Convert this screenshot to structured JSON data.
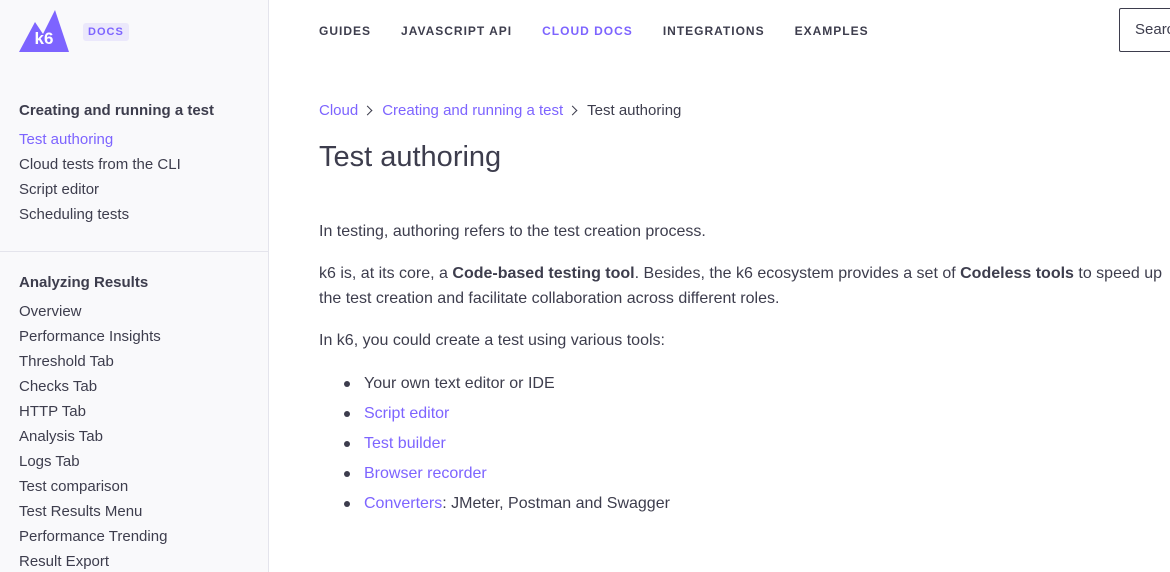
{
  "brand": {
    "logo_text": "k6",
    "badge": "DOCS",
    "accent_color": "#7d64ff",
    "logo_color": "#7d64ff"
  },
  "topnav": {
    "items": [
      {
        "label": "GUIDES"
      },
      {
        "label": "JAVASCRIPT API"
      },
      {
        "label": "CLOUD DOCS",
        "active": true
      },
      {
        "label": "INTEGRATIONS"
      },
      {
        "label": "EXAMPLES"
      }
    ],
    "search_placeholder": "Search"
  },
  "sidebar": {
    "sections": [
      {
        "heading": "Creating and running a test",
        "items": [
          {
            "label": "Test authoring",
            "active": true
          },
          {
            "label": "Cloud tests from the CLI"
          },
          {
            "label": "Script editor"
          },
          {
            "label": "Scheduling tests"
          }
        ]
      },
      {
        "heading": "Analyzing Results",
        "items": [
          {
            "label": "Overview"
          },
          {
            "label": "Performance Insights"
          },
          {
            "label": "Threshold Tab"
          },
          {
            "label": "Checks Tab"
          },
          {
            "label": "HTTP Tab"
          },
          {
            "label": "Analysis Tab"
          },
          {
            "label": "Logs Tab"
          },
          {
            "label": "Test comparison"
          },
          {
            "label": "Test Results Menu"
          },
          {
            "label": "Performance Trending"
          },
          {
            "label": "Result Export"
          }
        ]
      }
    ]
  },
  "breadcrumb": [
    "Cloud",
    "Creating and running a test",
    "Test authoring"
  ],
  "content": {
    "title": "Test authoring",
    "p1": "In testing, authoring refers to the test creation process.",
    "p2": {
      "a": "k6 is, at its core, a ",
      "b": "Code-based testing tool",
      "c": ". Besides, the k6 ecosystem provides a set of ",
      "d": "Codeless tools",
      "e": " to speed up the test creation and facilitate collaboration across different roles."
    },
    "p3": "In k6, you could create a test using various tools:",
    "list": [
      {
        "text": "Your own text editor or IDE"
      },
      {
        "link": "Script editor"
      },
      {
        "link": "Test builder"
      },
      {
        "link": "Browser recorder"
      },
      {
        "link": "Converters",
        "suffix": ": JMeter, Postman and Swagger"
      }
    ]
  }
}
